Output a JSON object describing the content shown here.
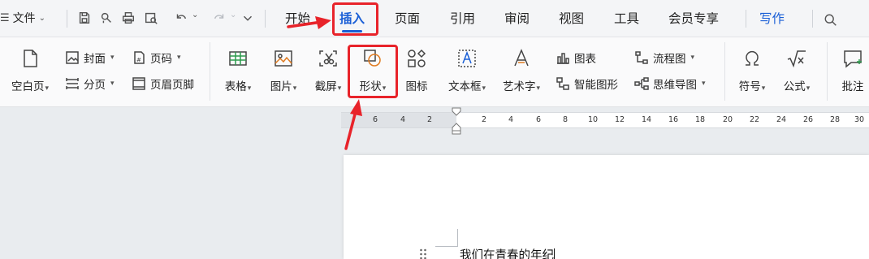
{
  "titlebar": {
    "file_menu": "文件",
    "tabs": [
      "开始",
      "插入",
      "页面",
      "引用",
      "审阅",
      "视图",
      "工具",
      "会员专享"
    ],
    "active_tab": "插入",
    "write_tab": "写作"
  },
  "ribbon": {
    "blank_page": "空白页",
    "cover": "封面",
    "page_break": "分页",
    "page_number": "页码",
    "header_footer": "页眉页脚",
    "table": "表格",
    "picture": "图片",
    "screenshot": "截屏",
    "shape": "形状",
    "icon": "图标",
    "textbox": "文本框",
    "wordart": "艺术字",
    "chart": "图表",
    "smartart": "智能图形",
    "flowchart": "流程图",
    "mindmap": "思维导图",
    "symbol": "符号",
    "formula": "公式",
    "comment": "批注"
  },
  "ruler": {
    "ticks": [
      "6",
      "4",
      "2",
      "2",
      "4",
      "6",
      "8",
      "10",
      "12",
      "14",
      "16",
      "18",
      "20",
      "22",
      "24",
      "26",
      "28",
      "30"
    ]
  },
  "document": {
    "text": "我们在青春的年纪"
  },
  "colors": {
    "accent": "#1a5fd6",
    "annotation": "#e8232a"
  }
}
